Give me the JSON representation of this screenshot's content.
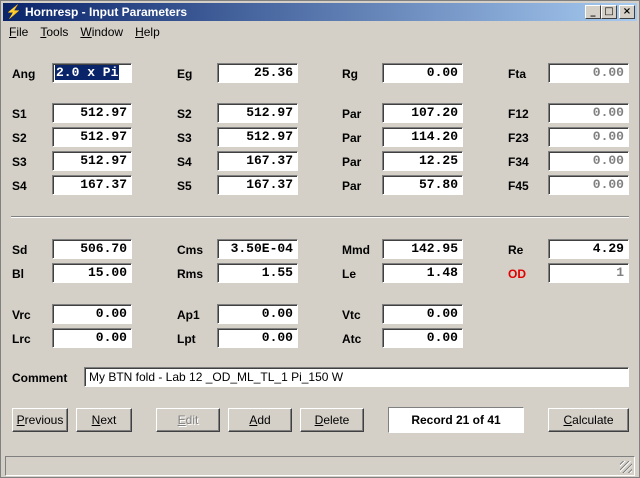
{
  "window": {
    "title": "Hornresp - Input Parameters",
    "icon": "lightning-icon",
    "minimize": "_",
    "maximize": "□",
    "close": "×"
  },
  "menu": [
    {
      "label": "File",
      "key": "F",
      "rest": "ile"
    },
    {
      "label": "Tools",
      "key": "T",
      "rest": "ools"
    },
    {
      "label": "Window",
      "key": "W",
      "rest": "indow"
    },
    {
      "label": "Help",
      "key": "H",
      "rest": "elp"
    }
  ],
  "labels": {
    "ang": "Ang",
    "eg": "Eg",
    "rg": "Rg",
    "fta": "Fta",
    "s1": "S1",
    "s2a": "S2",
    "par1": "Par",
    "f12": "F12",
    "s2b": "S2",
    "s3a": "S3",
    "par2": "Par",
    "f23": "F23",
    "s3b": "S3",
    "s4a": "S4",
    "par3": "Par",
    "f34": "F34",
    "s4b": "S4",
    "s5": "S5",
    "par4": "Par",
    "f45": "F45",
    "sd": "Sd",
    "cms": "Cms",
    "mmd": "Mmd",
    "re": "Re",
    "bl": "Bl",
    "rms": "Rms",
    "le": "Le",
    "od": "OD",
    "vrc": "Vrc",
    "ap1": "Ap1",
    "vtc": "Vtc",
    "lrc": "Lrc",
    "lpt": "Lpt",
    "atc": "Atc",
    "comment": "Comment"
  },
  "values": {
    "ang": "2.0 x Pi",
    "eg": "25.36",
    "rg": "0.00",
    "fta": "0.00",
    "s1": "512.97",
    "s2a": "512.97",
    "par1": "107.20",
    "f12": "0.00",
    "s2b": "512.97",
    "s3a": "512.97",
    "par2": "114.20",
    "f23": "0.00",
    "s3b": "512.97",
    "s4a": "167.37",
    "par3": "12.25",
    "f34": "0.00",
    "s4b": "167.37",
    "s5": "167.37",
    "par4": "57.80",
    "f45": "0.00",
    "sd": "506.70",
    "cms": "3.50E-04",
    "mmd": "142.95",
    "re": "4.29",
    "bl": "15.00",
    "rms": "1.55",
    "le": "1.48",
    "od": "1",
    "vrc": "0.00",
    "ap1": "0.00",
    "vtc": "0.00",
    "lrc": "0.00",
    "lpt": "0.00",
    "atc": "0.00",
    "comment": "My BTN fold  - Lab 12 _OD_ML_TL_1 Pi_150 W"
  },
  "buttons": {
    "previous": {
      "key": "P",
      "rest": "revious"
    },
    "next": {
      "key": "N",
      "rest": "ext"
    },
    "edit": {
      "key": "E",
      "rest": "dit"
    },
    "add": {
      "key": "A",
      "rest": "dd"
    },
    "delete": {
      "key": "D",
      "rest": "elete"
    },
    "calculate": {
      "key": "C",
      "rest": "alculate"
    }
  },
  "record": "Record 21 of 41",
  "colors": {
    "title_start": "#0a246a",
    "title_end": "#a6caf0",
    "face": "#d4d0c8",
    "od_label": "#e00000"
  }
}
